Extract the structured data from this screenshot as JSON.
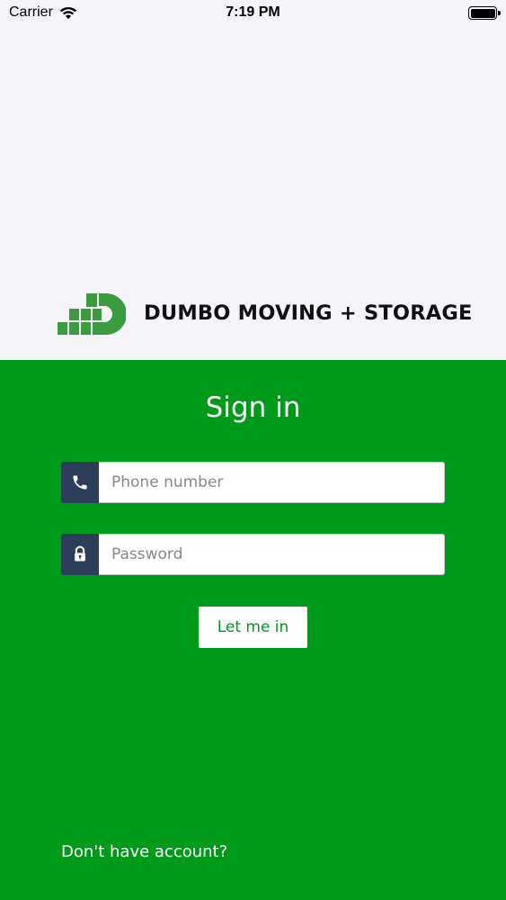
{
  "status_bar": {
    "carrier": "Carrier",
    "time": "7:19 PM",
    "battery_level": 1.0
  },
  "brand": {
    "name": "DUMBO MOVING + STORAGE",
    "logo_color": "#3a9c3e"
  },
  "signin": {
    "title": "Sign in",
    "phone_placeholder": "Phone number",
    "password_placeholder": "Password",
    "submit_label": "Let me in",
    "no_account_link": "Don't have account?"
  },
  "colors": {
    "background_top": "#f4f4f9",
    "background_green": "#009a1a",
    "icon_box": "#2c3e5a",
    "button_text": "#009a1a"
  },
  "icons": {
    "phone": "phone-icon",
    "password": "lock-icon",
    "wifi": "wifi-icon",
    "battery": "battery-icon"
  }
}
